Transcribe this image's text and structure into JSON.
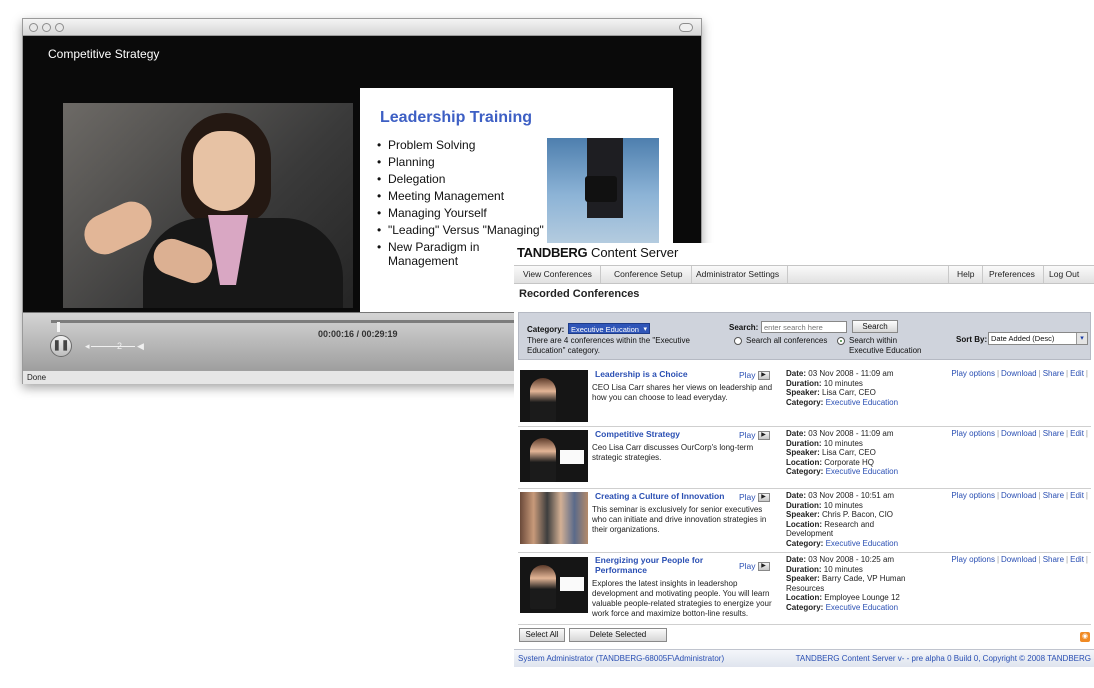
{
  "player": {
    "title": "Competitive Strategy",
    "slide": {
      "title": "Leadership Training",
      "bullets": [
        "Problem Solving",
        "Planning",
        "Delegation",
        "Meeting Management",
        "Managing Yourself",
        "\"Leading\" Versus \"Managing\"",
        "New Paradigm in Management"
      ]
    },
    "timecode": "00:00:16 / 00:29:19",
    "volume_knob": "2",
    "status": "Done",
    "progress": 0.009
  },
  "server": {
    "brand_bold": "TANDBERG",
    "brand_rest": "Content Server",
    "nav_left": [
      "View Conferences",
      "Conference Setup",
      "Administrator Settings"
    ],
    "nav_right": [
      "Help",
      "Preferences",
      "Log Out"
    ],
    "page_title": "Recorded Conferences",
    "filter": {
      "category_label": "Category:",
      "category_value": "Executive Education",
      "category_note": "There are 4 conferences within the \"Executive Education\" category.",
      "search_label": "Search:",
      "search_placeholder": "enter search here",
      "search_button": "Search",
      "radio_all": "Search all conferences",
      "radio_within": "Search within Executive Education",
      "sort_label": "Sort By:",
      "sort_value": "Date Added (Desc)"
    },
    "labels": {
      "play": "Play",
      "date": "Date:",
      "duration": "Duration:",
      "speaker": "Speaker:",
      "location": "Location:",
      "category": "Category:",
      "play_options": "Play options",
      "download": "Download",
      "share": "Share",
      "edit": "Edit"
    },
    "conferences": [
      {
        "title": "Leadership is a Choice",
        "description": "CEO Lisa Carr shares her views on leadership and how you can choose to lead everyday.",
        "date": "03 Nov 2008 - 11:09 am",
        "duration": "10 minutes",
        "speaker": "Lisa Carr, CEO",
        "location": "",
        "category": "Executive Education"
      },
      {
        "title": "Competitive Strategy",
        "description": "Ceo Lisa Carr discusses OurCorp's long-term strategic strategies.",
        "date": "03 Nov 2008 - 11:09 am",
        "duration": "10 minutes",
        "speaker": "Lisa Carr, CEO",
        "location": "Corporate HQ",
        "category": "Executive Education"
      },
      {
        "title": "Creating a Culture of Innovation",
        "description": "This seminar is exclusively for senior executives who can initiate and drive innovation strategies in their organizations.",
        "date": "03 Nov 2008 - 10:51 am",
        "duration": "10 minutes",
        "speaker": "Chris P. Bacon, CIO",
        "location": "Research and Development",
        "category": "Executive Education"
      },
      {
        "title": "Energizing your People for Performance",
        "description": "Explores the latest insights in leadershop development and motivating people. You will learn valuable people-related strategies to energize your work force and maximize botton-line results.",
        "date": "03 Nov 2008 - 10:25 am",
        "duration": "10 minutes",
        "speaker": "Barry Cade, VP Human Resources",
        "location": "Employee Lounge 12",
        "category": "Executive Education"
      }
    ],
    "select_all": "Select All",
    "delete_selected": "Delete Selected",
    "footer_left": "System Administrator (TANDBERG-68005F\\Administrator)",
    "footer_right": "TANDBERG Content Server v- - pre alpha 0 Build 0, Copyright © 2008 TANDBERG"
  }
}
